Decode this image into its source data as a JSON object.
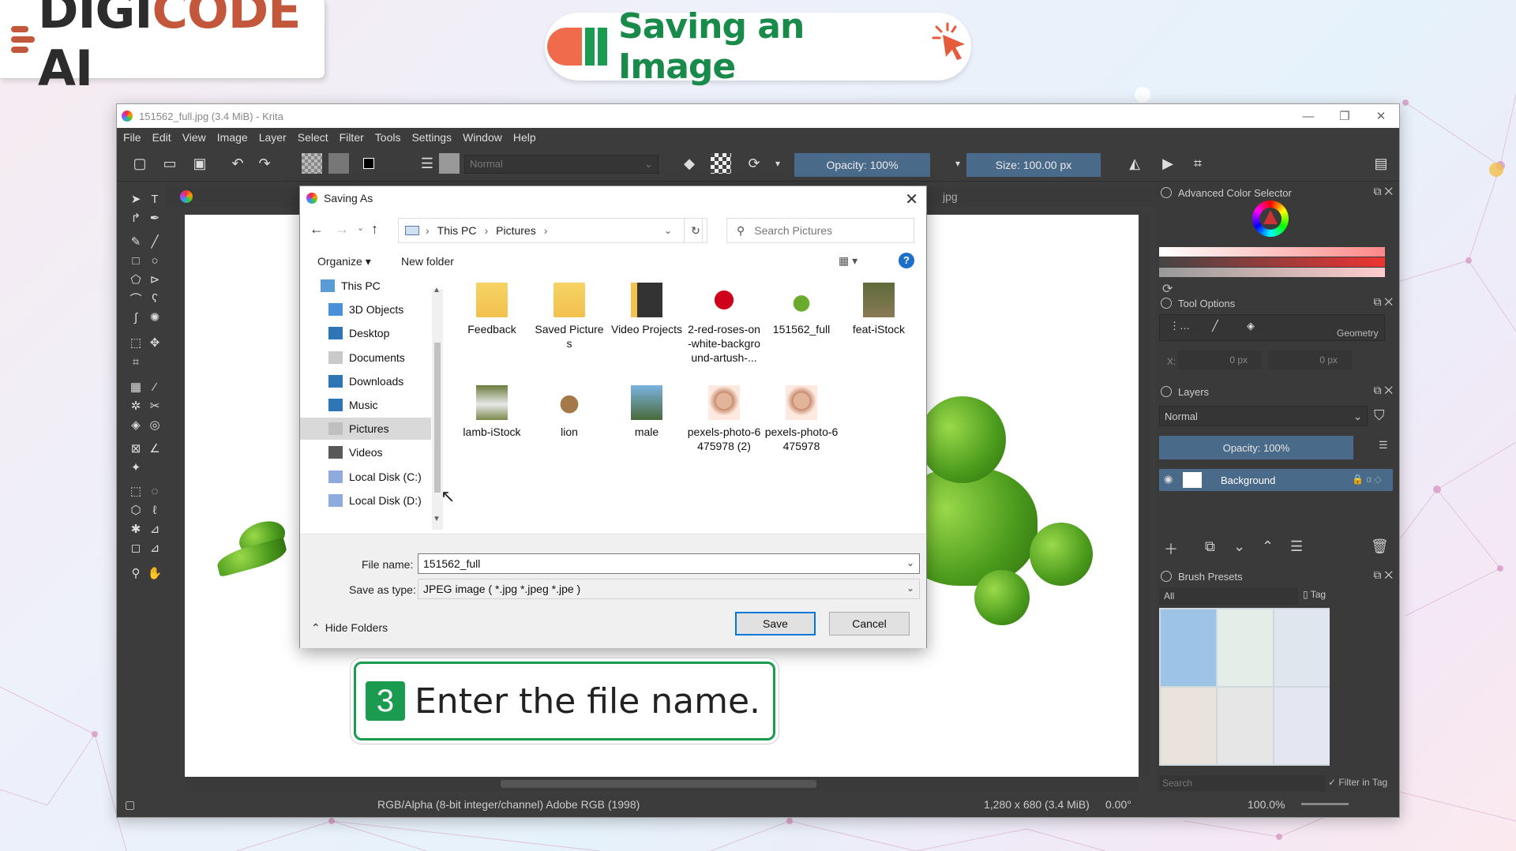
{
  "branding": {
    "logo_text_dark": "DIGI",
    "logo_text_accent": "CODE",
    "logo_text_tail": " AI"
  },
  "banner": {
    "title": "Saving an Image"
  },
  "window": {
    "title": "151562_full.jpg (3.4 MiB)  - Krita",
    "menu": [
      "File",
      "Edit",
      "View",
      "Image",
      "Layer",
      "Select",
      "Filter",
      "Tools",
      "Settings",
      "Window",
      "Help"
    ],
    "toolbar": {
      "blend_mode": "Normal",
      "opacity": "Opacity: 100%",
      "size": "Size: 100.00 px"
    },
    "canvas_tab": "jpg"
  },
  "dockers": {
    "color_selector": {
      "title": "Advanced Color Selector"
    },
    "tool_options": {
      "title": "Tool Options",
      "section": "Geometry",
      "x_label": "X:",
      "x_value": "0 px",
      "y_value": "0 px"
    },
    "layers": {
      "title": "Layers",
      "blend_mode": "Normal",
      "opacity": "Opacity:  100%",
      "layer_name": "Background"
    },
    "brush_presets": {
      "title": "Brush Presets",
      "filter": "All",
      "tag": "Tag",
      "search_placeholder": "Search",
      "filter_in_tag": "Filter in Tag"
    }
  },
  "statusbar": {
    "color_info": "RGB/Alpha (8-bit integer/channel)  Adobe RGB (1998)",
    "dimensions": "1,280 x 680 (3.4 MiB)",
    "rotation": "0.00°",
    "zoom": "100.0%"
  },
  "dialog": {
    "title": "Saving As",
    "breadcrumb": [
      "This PC",
      "Pictures"
    ],
    "search_placeholder": "Search Pictures",
    "organize": "Organize",
    "new_folder": "New folder",
    "nav_items": [
      "This PC",
      "3D Objects",
      "Desktop",
      "Documents",
      "Downloads",
      "Music",
      "Pictures",
      "Videos",
      "Local Disk (C:)",
      "Local Disk (D:)"
    ],
    "files": [
      {
        "name": "Feedback",
        "kind": "folder"
      },
      {
        "name": "Saved Pictures",
        "kind": "folder"
      },
      {
        "name": "Video Projects",
        "kind": "folder-dark"
      },
      {
        "name": "2-red-roses-on-white-background-artush-...",
        "kind": "roses"
      },
      {
        "name": "151562_full",
        "kind": "peas"
      },
      {
        "name": "feat-iStock",
        "kind": "animal"
      },
      {
        "name": "lamb-iStock",
        "kind": "lamb"
      },
      {
        "name": "lion",
        "kind": "lion"
      },
      {
        "name": "male",
        "kind": "elephant"
      },
      {
        "name": "pexels-photo-6475978 (2)",
        "kind": "person"
      },
      {
        "name": "pexels-photo-6475978",
        "kind": "person"
      }
    ],
    "file_name_label": "File name:",
    "file_name_value": "151562_full",
    "save_type_label": "Save as type:",
    "save_type_value": "JPEG image ( *.jpg *.jpeg *.jpe )",
    "hide_folders": "Hide Folders",
    "save_button": "Save",
    "cancel_button": "Cancel"
  },
  "callout": {
    "step_number": "3",
    "text": "Enter the file name."
  },
  "colors": {
    "accent_green": "#1a9b50",
    "accent_orange": "#ef6b4c",
    "krita_bg": "#3c3c3c",
    "selection_blue": "#4a6a8a"
  }
}
